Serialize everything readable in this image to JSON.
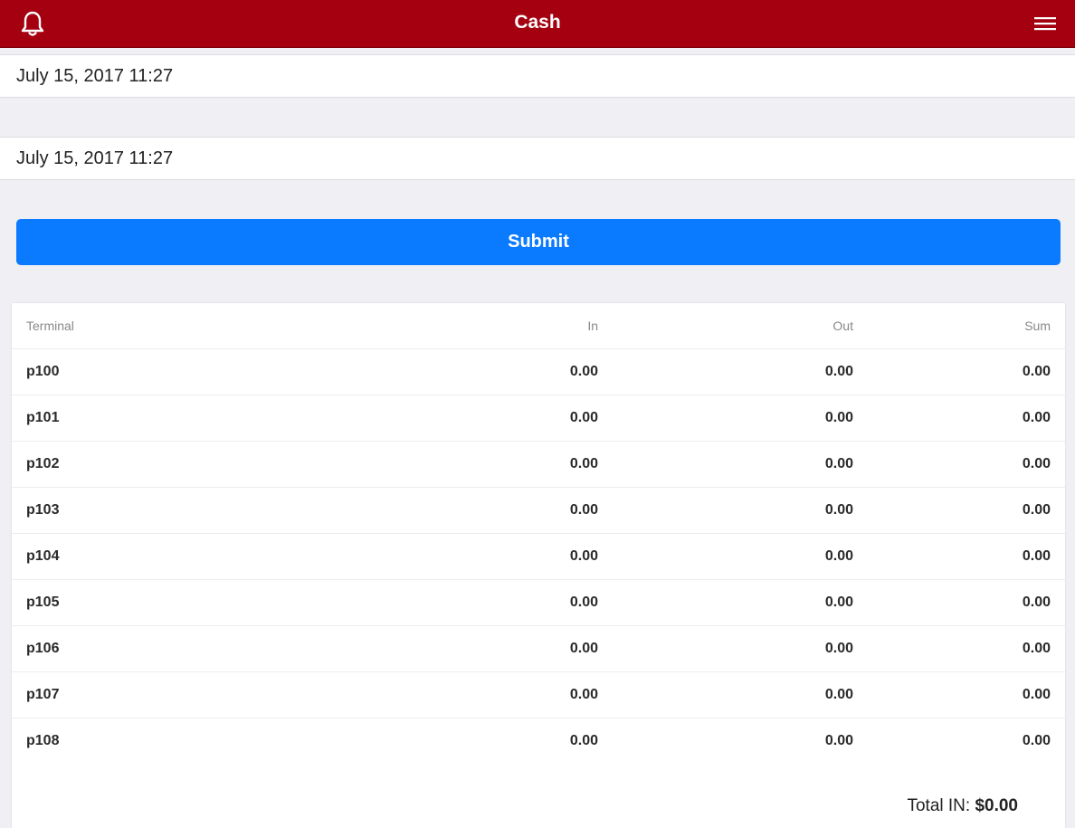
{
  "header": {
    "title": "Cash",
    "bell_icon": "bell-icon",
    "menu_icon": "hamburger-menu-icon"
  },
  "date_from": {
    "value": "July 15, 2017 11:27"
  },
  "date_to": {
    "value": "July 15, 2017 11:27"
  },
  "submit_label": "Submit",
  "table": {
    "headers": [
      "Terminal",
      "In",
      "Out",
      "Sum"
    ],
    "rows": [
      [
        "p100",
        "0.00",
        "0.00",
        "0.00"
      ],
      [
        "p101",
        "0.00",
        "0.00",
        "0.00"
      ],
      [
        "p102",
        "0.00",
        "0.00",
        "0.00"
      ],
      [
        "p103",
        "0.00",
        "0.00",
        "0.00"
      ],
      [
        "p104",
        "0.00",
        "0.00",
        "0.00"
      ],
      [
        "p105",
        "0.00",
        "0.00",
        "0.00"
      ],
      [
        "p106",
        "0.00",
        "0.00",
        "0.00"
      ],
      [
        "p107",
        "0.00",
        "0.00",
        "0.00"
      ],
      [
        "p108",
        "0.00",
        "0.00",
        "0.00"
      ]
    ]
  },
  "total": {
    "label": "Total IN:",
    "value": "$0.00"
  },
  "colors": {
    "header_bg": "#a4000f",
    "button_bg": "#0a7aff",
    "page_bg": "#efeff4"
  }
}
